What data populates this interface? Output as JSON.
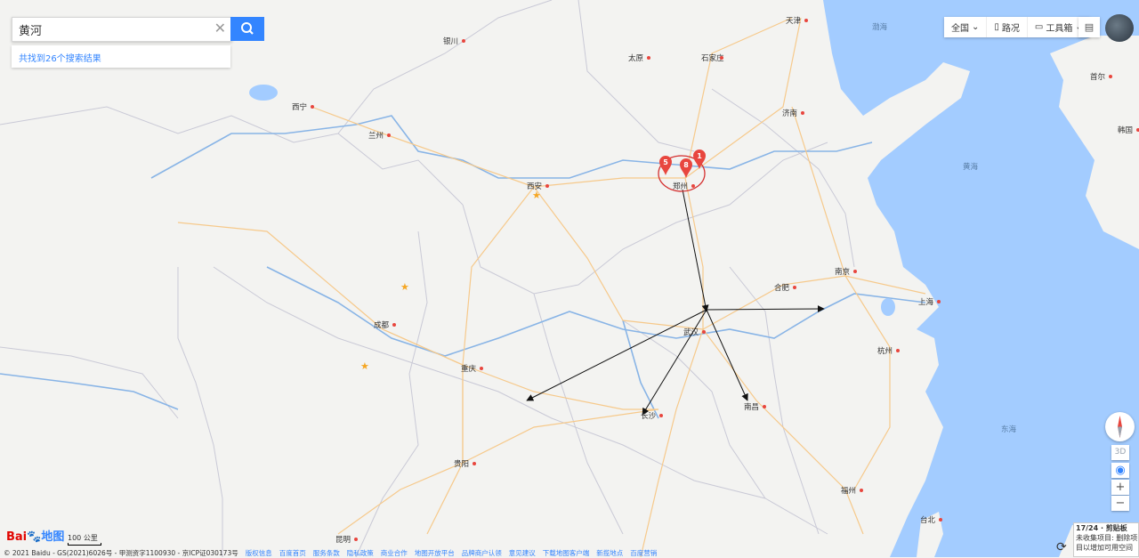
{
  "search": {
    "query": "黄河",
    "result_summary": "共找到26个搜索结果"
  },
  "toolbar": {
    "region": "全国",
    "traffic": "路况",
    "tools": "工具箱"
  },
  "zoom": {
    "three_d": "3D",
    "zoom_in": "+",
    "zoom_out": "−"
  },
  "scale": {
    "label": "100 公里"
  },
  "logo": {
    "bai": "Bai",
    "du": "du",
    "ditu": "地图"
  },
  "markers": [
    {
      "label": "5",
      "color": "#e8463e"
    },
    {
      "label": "8",
      "color": "#e8463e"
    },
    {
      "label": "1",
      "color": "#e8463e"
    }
  ],
  "cities": [
    {
      "name": "天津"
    },
    {
      "name": "银川"
    },
    {
      "name": "太原"
    },
    {
      "name": "石家庄"
    },
    {
      "name": "济南"
    },
    {
      "name": "西宁"
    },
    {
      "name": "兰州"
    },
    {
      "name": "西安"
    },
    {
      "name": "郑州"
    },
    {
      "name": "南京"
    },
    {
      "name": "合肥"
    },
    {
      "name": "上海"
    },
    {
      "name": "成都"
    },
    {
      "name": "武汉"
    },
    {
      "name": "杭州"
    },
    {
      "name": "重庆"
    },
    {
      "name": "南昌"
    },
    {
      "name": "长沙"
    },
    {
      "name": "贵阳"
    },
    {
      "name": "福州"
    },
    {
      "name": "台北"
    },
    {
      "name": "昆明"
    },
    {
      "name": "首尔"
    },
    {
      "name": "韩国"
    }
  ],
  "seas": [
    {
      "name": "渤海"
    },
    {
      "name": "黄海"
    },
    {
      "name": "东海"
    }
  ],
  "footer": {
    "copyright": "© 2021 Baidu - GS(2021)6026号 - 甲测资字1100930 - 京ICP证030173号",
    "links": [
      "版权信息",
      "百度首页",
      "服务条款",
      "隐私政策",
      "商业合作",
      "地图开放平台",
      "品牌商户认领",
      "意见建议",
      "下载地图客户端",
      "新揽地点",
      "百度营销"
    ]
  },
  "clipboard": {
    "title": "17/24 · 剪贴板",
    "line1": "未收集项目: 删除项",
    "line2": "目以增加可用空间"
  },
  "colors": {
    "accent": "#3385ff",
    "marker": "#e8463e",
    "sea": "#a3ccff",
    "land": "#f4f4f2",
    "road": "#f6c98b"
  }
}
